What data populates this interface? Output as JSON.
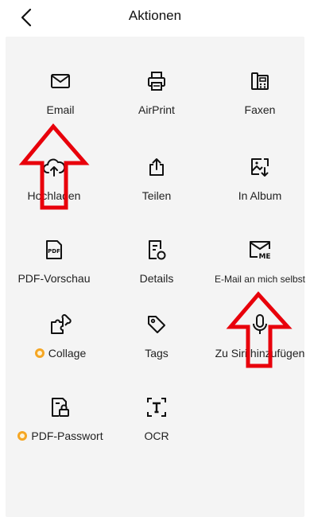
{
  "header": {
    "title": "Aktionen",
    "back_icon": "chevron-left-icon"
  },
  "actions": [
    {
      "label": "Email",
      "icon": "envelope-icon",
      "premium": false
    },
    {
      "label": "AirPrint",
      "icon": "printer-icon",
      "premium": false
    },
    {
      "label": "Faxen",
      "icon": "fax-icon",
      "premium": false
    },
    {
      "label": "Hochladen",
      "icon": "cloud-upload-icon",
      "premium": false
    },
    {
      "label": "Teilen",
      "icon": "share-icon",
      "premium": false
    },
    {
      "label": "In Album",
      "icon": "image-download-icon",
      "premium": false
    },
    {
      "label": "PDF-Vorschau",
      "icon": "pdf-file-icon",
      "premium": false
    },
    {
      "label": "Details",
      "icon": "document-details-icon",
      "premium": false
    },
    {
      "label": "E-Mail an mich selbst",
      "icon": "mail-me-icon",
      "premium": false
    },
    {
      "label": "Collage",
      "icon": "puzzle-icon",
      "premium": true
    },
    {
      "label": "Tags",
      "icon": "tag-icon",
      "premium": false
    },
    {
      "label": "Zu Siri hinzufügen",
      "icon": "microphone-icon",
      "premium": false
    },
    {
      "label": "PDF-Passwort",
      "icon": "locked-file-icon",
      "premium": true
    },
    {
      "label": "OCR",
      "icon": "ocr-text-icon",
      "premium": false
    }
  ],
  "colors": {
    "panel": "#f4f4f4",
    "premium": "#f5a623",
    "annotation_arrow": "#e8000b"
  },
  "annotations": [
    "red-arrow-up-on-hochladen",
    "red-arrow-up-on-siri"
  ]
}
